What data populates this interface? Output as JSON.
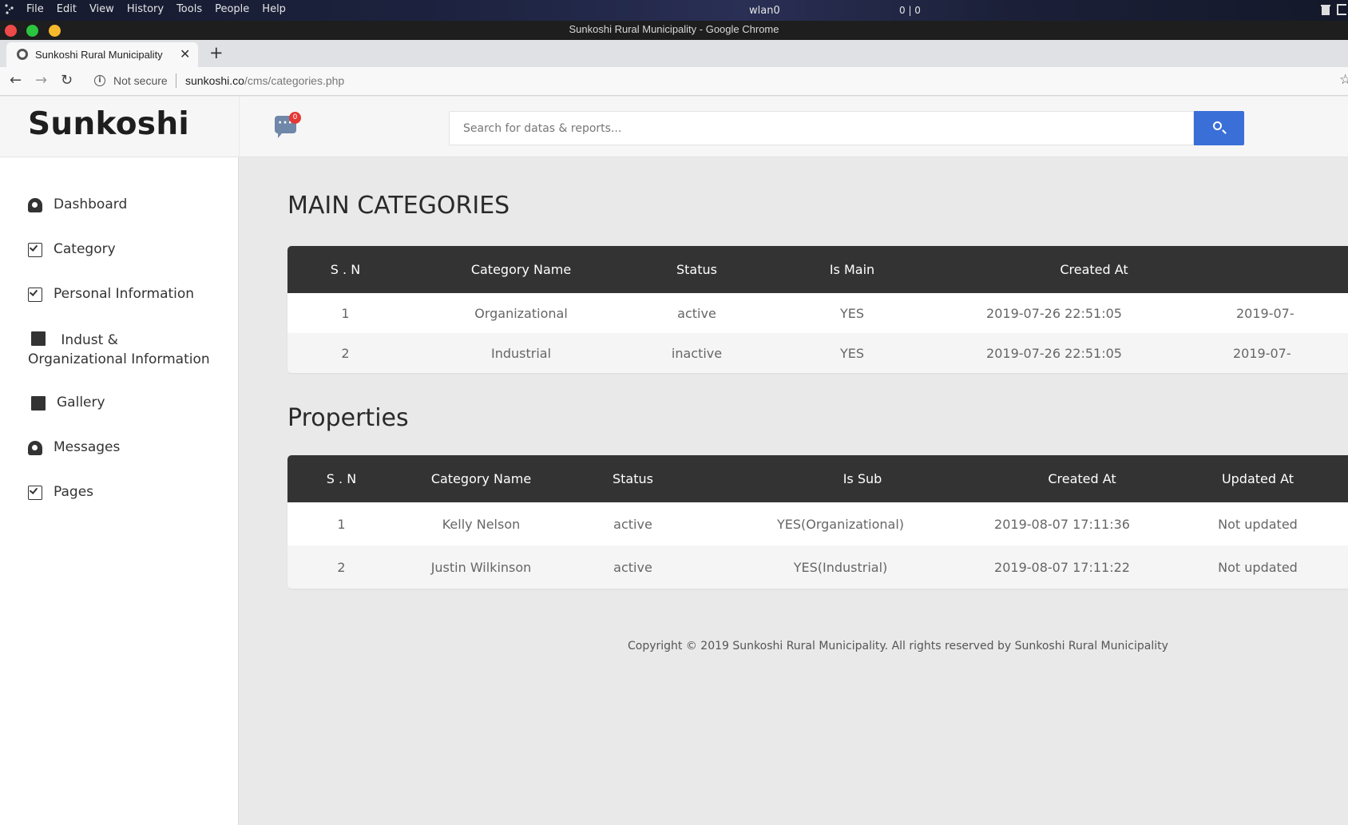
{
  "os": {
    "menu": [
      "File",
      "Edit",
      "View",
      "History",
      "Tools",
      "People",
      "Help"
    ],
    "network_name": "wlan0",
    "net_stats": "0 | 0"
  },
  "browser": {
    "window_title": "Sunkoshi Rural Municipality - Google Chrome",
    "tab_title": "Sunkoshi Rural Municipality",
    "security_label": "Not secure",
    "url_domain": "sunkoshi.co",
    "url_path": "/cms/categories.php"
  },
  "brand": "Sunkoshi",
  "topbar": {
    "message_count": "0",
    "search_placeholder": "Search for datas & reports..."
  },
  "sidebar": {
    "items": [
      {
        "label": "Dashboard",
        "icon": "gauge-icon"
      },
      {
        "label": "Category",
        "icon": "check-square-icon"
      },
      {
        "label": "Personal Information",
        "icon": "check-square-icon"
      },
      {
        "label": "Indust & Organizational Information",
        "icon": "copy-icon"
      },
      {
        "label": "Gallery",
        "icon": "copy-icon"
      },
      {
        "label": "Messages",
        "icon": "gauge-icon"
      },
      {
        "label": "Pages",
        "icon": "check-square-icon"
      }
    ]
  },
  "main_categories": {
    "title": "MAIN CATEGORIES",
    "columns": [
      "S . N",
      "Category Name",
      "Status",
      "Is Main",
      "Created At"
    ],
    "rows": [
      [
        "1",
        "Organizational",
        "active",
        "YES",
        "2019-07-26 22:51:05",
        "2019-07-"
      ],
      [
        "2",
        "Industrial",
        "inactive",
        "YES",
        "2019-07-26 22:51:05",
        "2019-07-"
      ]
    ]
  },
  "properties": {
    "title": "Properties",
    "columns": [
      "S . N",
      "Category Name",
      "Status",
      "Is Sub",
      "Created At",
      "Updated At"
    ],
    "rows": [
      [
        "1",
        "Kelly Nelson",
        "active",
        "YES(Organizational)",
        "2019-08-07 17:11:36",
        "Not updated"
      ],
      [
        "2",
        "Justin Wilkinson",
        "active",
        "YES(Industrial)",
        "2019-08-07 17:11:22",
        "Not updated"
      ]
    ]
  },
  "footer": "Copyright © 2019 Sunkoshi Rural Municipality. All rights reserved by Sunkoshi Rural Municipality",
  "colors": {
    "accent": "#3a6fd8",
    "table_header": "#333333",
    "badge": "#e53935"
  }
}
